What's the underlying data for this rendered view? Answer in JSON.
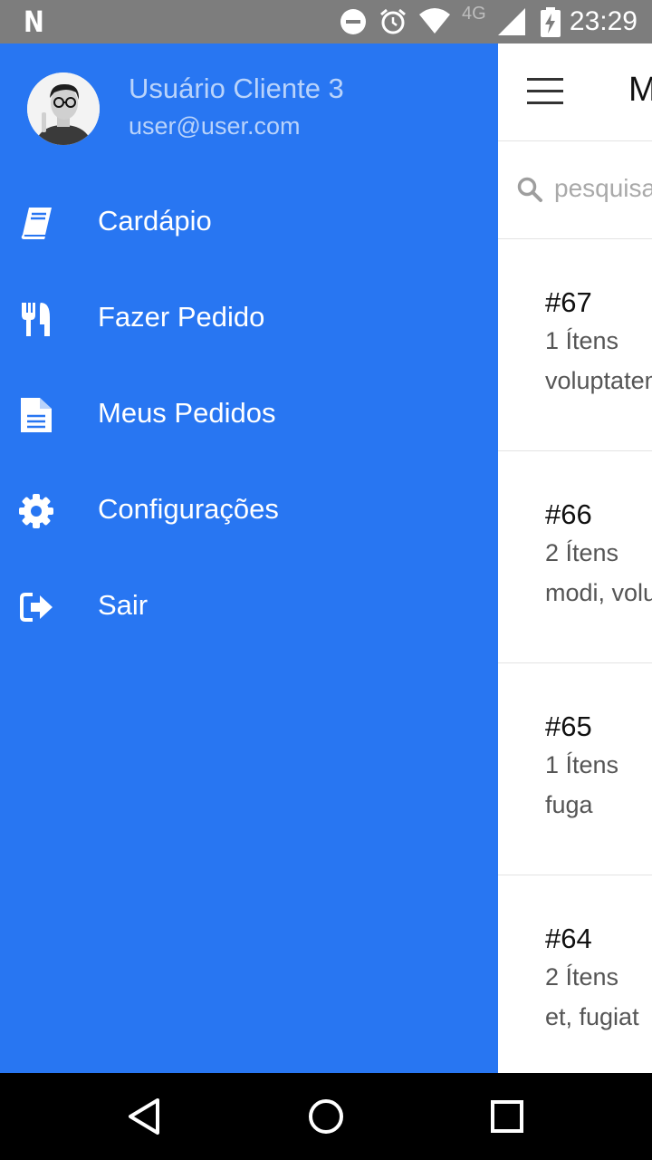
{
  "status_bar": {
    "time": "23:29",
    "network": "4G",
    "icons": [
      "n-logo-icon",
      "do-not-disturb-icon",
      "alarm-icon",
      "wifi-icon",
      "signal-icon",
      "battery-charging-icon"
    ]
  },
  "drawer": {
    "user_name": "Usuário Cliente 3",
    "user_email": "user@user.com",
    "items": [
      {
        "label": "Cardápio",
        "icon": "book-icon"
      },
      {
        "label": "Fazer Pedido",
        "icon": "utensils-icon"
      },
      {
        "label": "Meus Pedidos",
        "icon": "document-icon"
      },
      {
        "label": "Configurações",
        "icon": "gear-icon"
      },
      {
        "label": "Sair",
        "icon": "sign-out-icon"
      }
    ],
    "color": "#2876f2"
  },
  "main": {
    "title": "M",
    "search_placeholder": "pesquisa",
    "orders": [
      {
        "number": "#67",
        "items": "1 Ítens",
        "description": "voluptatem"
      },
      {
        "number": "#66",
        "items": "2 Ítens",
        "description": "modi, volu"
      },
      {
        "number": "#65",
        "items": "1 Ítens",
        "description": "fuga"
      },
      {
        "number": "#64",
        "items": "2 Ítens",
        "description": "et, fugiat"
      }
    ]
  },
  "nav_bar": {
    "icons": [
      "back-icon",
      "home-icon",
      "recents-icon"
    ]
  }
}
